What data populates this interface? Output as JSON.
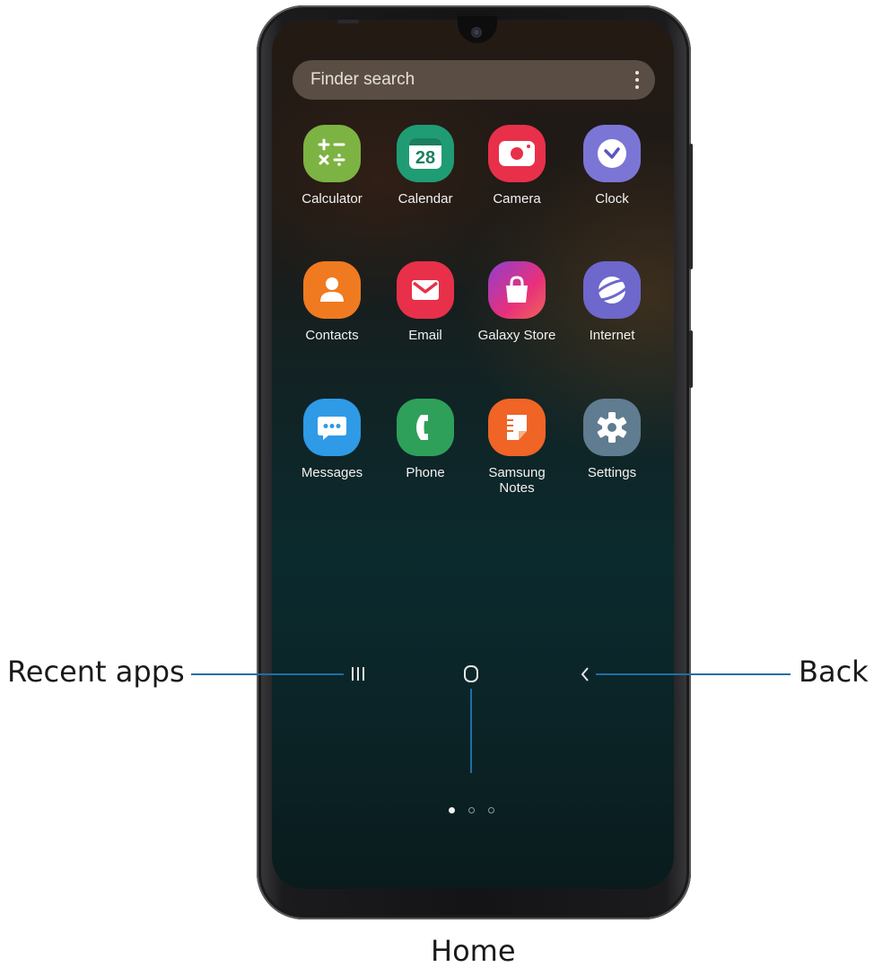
{
  "search": {
    "placeholder": "Finder search"
  },
  "apps": [
    {
      "name": "Calculator",
      "color": "#7db342",
      "icon": "calculator-icon"
    },
    {
      "name": "Calendar",
      "color": "#1f9c74",
      "icon": "calendar-icon",
      "day": "28"
    },
    {
      "name": "Camera",
      "color": "#e8304a",
      "icon": "camera-icon"
    },
    {
      "name": "Clock",
      "color": "#7b76d6",
      "icon": "clock-icon"
    },
    {
      "name": "Contacts",
      "color": "#f07a1f",
      "icon": "contacts-icon"
    },
    {
      "name": "Email",
      "color": "#e8304a",
      "icon": "email-icon"
    },
    {
      "name": "Galaxy Store",
      "color": "#d8307a",
      "icon": "galaxy-store-icon"
    },
    {
      "name": "Internet",
      "color": "#6e67cc",
      "icon": "internet-icon"
    },
    {
      "name": "Messages",
      "color": "#2f9ae6",
      "icon": "messages-icon"
    },
    {
      "name": "Phone",
      "color": "#2ea05a",
      "icon": "phone-icon"
    },
    {
      "name": "Samsung\nNotes",
      "color": "#f06426",
      "icon": "samsung-notes-icon"
    },
    {
      "name": "Settings",
      "color": "#5f7c90",
      "icon": "settings-icon"
    }
  ],
  "page_indicator": {
    "pages": 3,
    "current": 1
  },
  "callouts": {
    "recent_apps": "Recent apps",
    "home": "Home",
    "back": "Back"
  }
}
